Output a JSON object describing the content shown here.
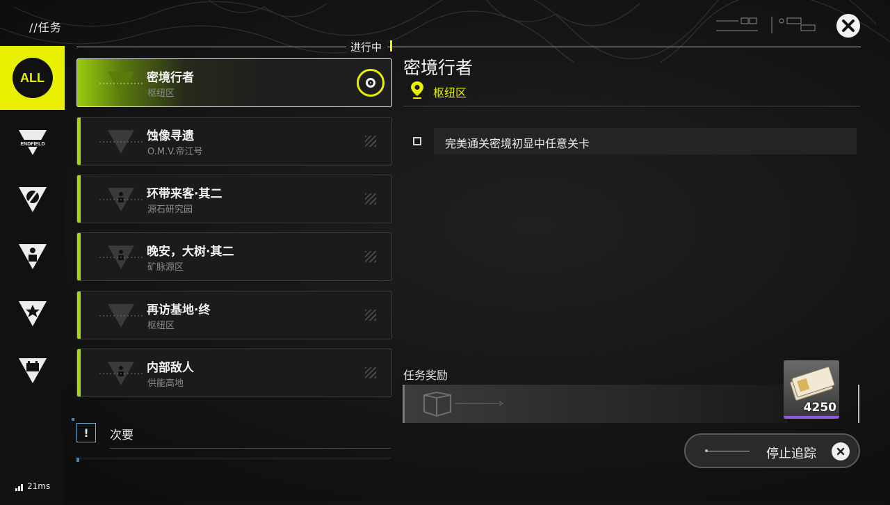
{
  "header": {
    "title": "//任务",
    "status_label": "进行中"
  },
  "sidebar": {
    "items": [
      {
        "label": "ALL",
        "icon": "all-icon"
      },
      {
        "label": "ENDFIELD",
        "icon": "endfield-icon"
      },
      {
        "label": "",
        "icon": "compass-icon"
      },
      {
        "label": "",
        "icon": "person-icon"
      },
      {
        "label": "",
        "icon": "star-icon"
      },
      {
        "label": "",
        "icon": "battery-icon"
      }
    ]
  },
  "quests": [
    {
      "name": "密境行者",
      "location": "枢纽区",
      "active": true
    },
    {
      "name": "蚀像寻遗",
      "location": "O.M.V.帝江号",
      "active": false
    },
    {
      "name": "环带来客·其二",
      "location": "源石研究园",
      "active": false
    },
    {
      "name": "晚安，大树·其二",
      "location": "矿脉源区",
      "active": false
    },
    {
      "name": "再访基地·终",
      "location": "枢纽区",
      "active": false
    },
    {
      "name": "内部敌人",
      "location": "供能高地",
      "active": false
    }
  ],
  "secondary": {
    "icon_text": "!",
    "label": "次要"
  },
  "detail": {
    "title": "密境行者",
    "location": "枢纽区",
    "objective": "完美通关密境初显中任意关卡",
    "reward_label": "任务奖励",
    "reward_quantity": "4250"
  },
  "stop_tracking": {
    "label": "停止追踪"
  },
  "ping": {
    "value": "21ms"
  },
  "colors": {
    "accent_yellow": "#e8f000",
    "quest_bar_green": "#a6d812",
    "rarity_purple": "#8b5ed8"
  }
}
